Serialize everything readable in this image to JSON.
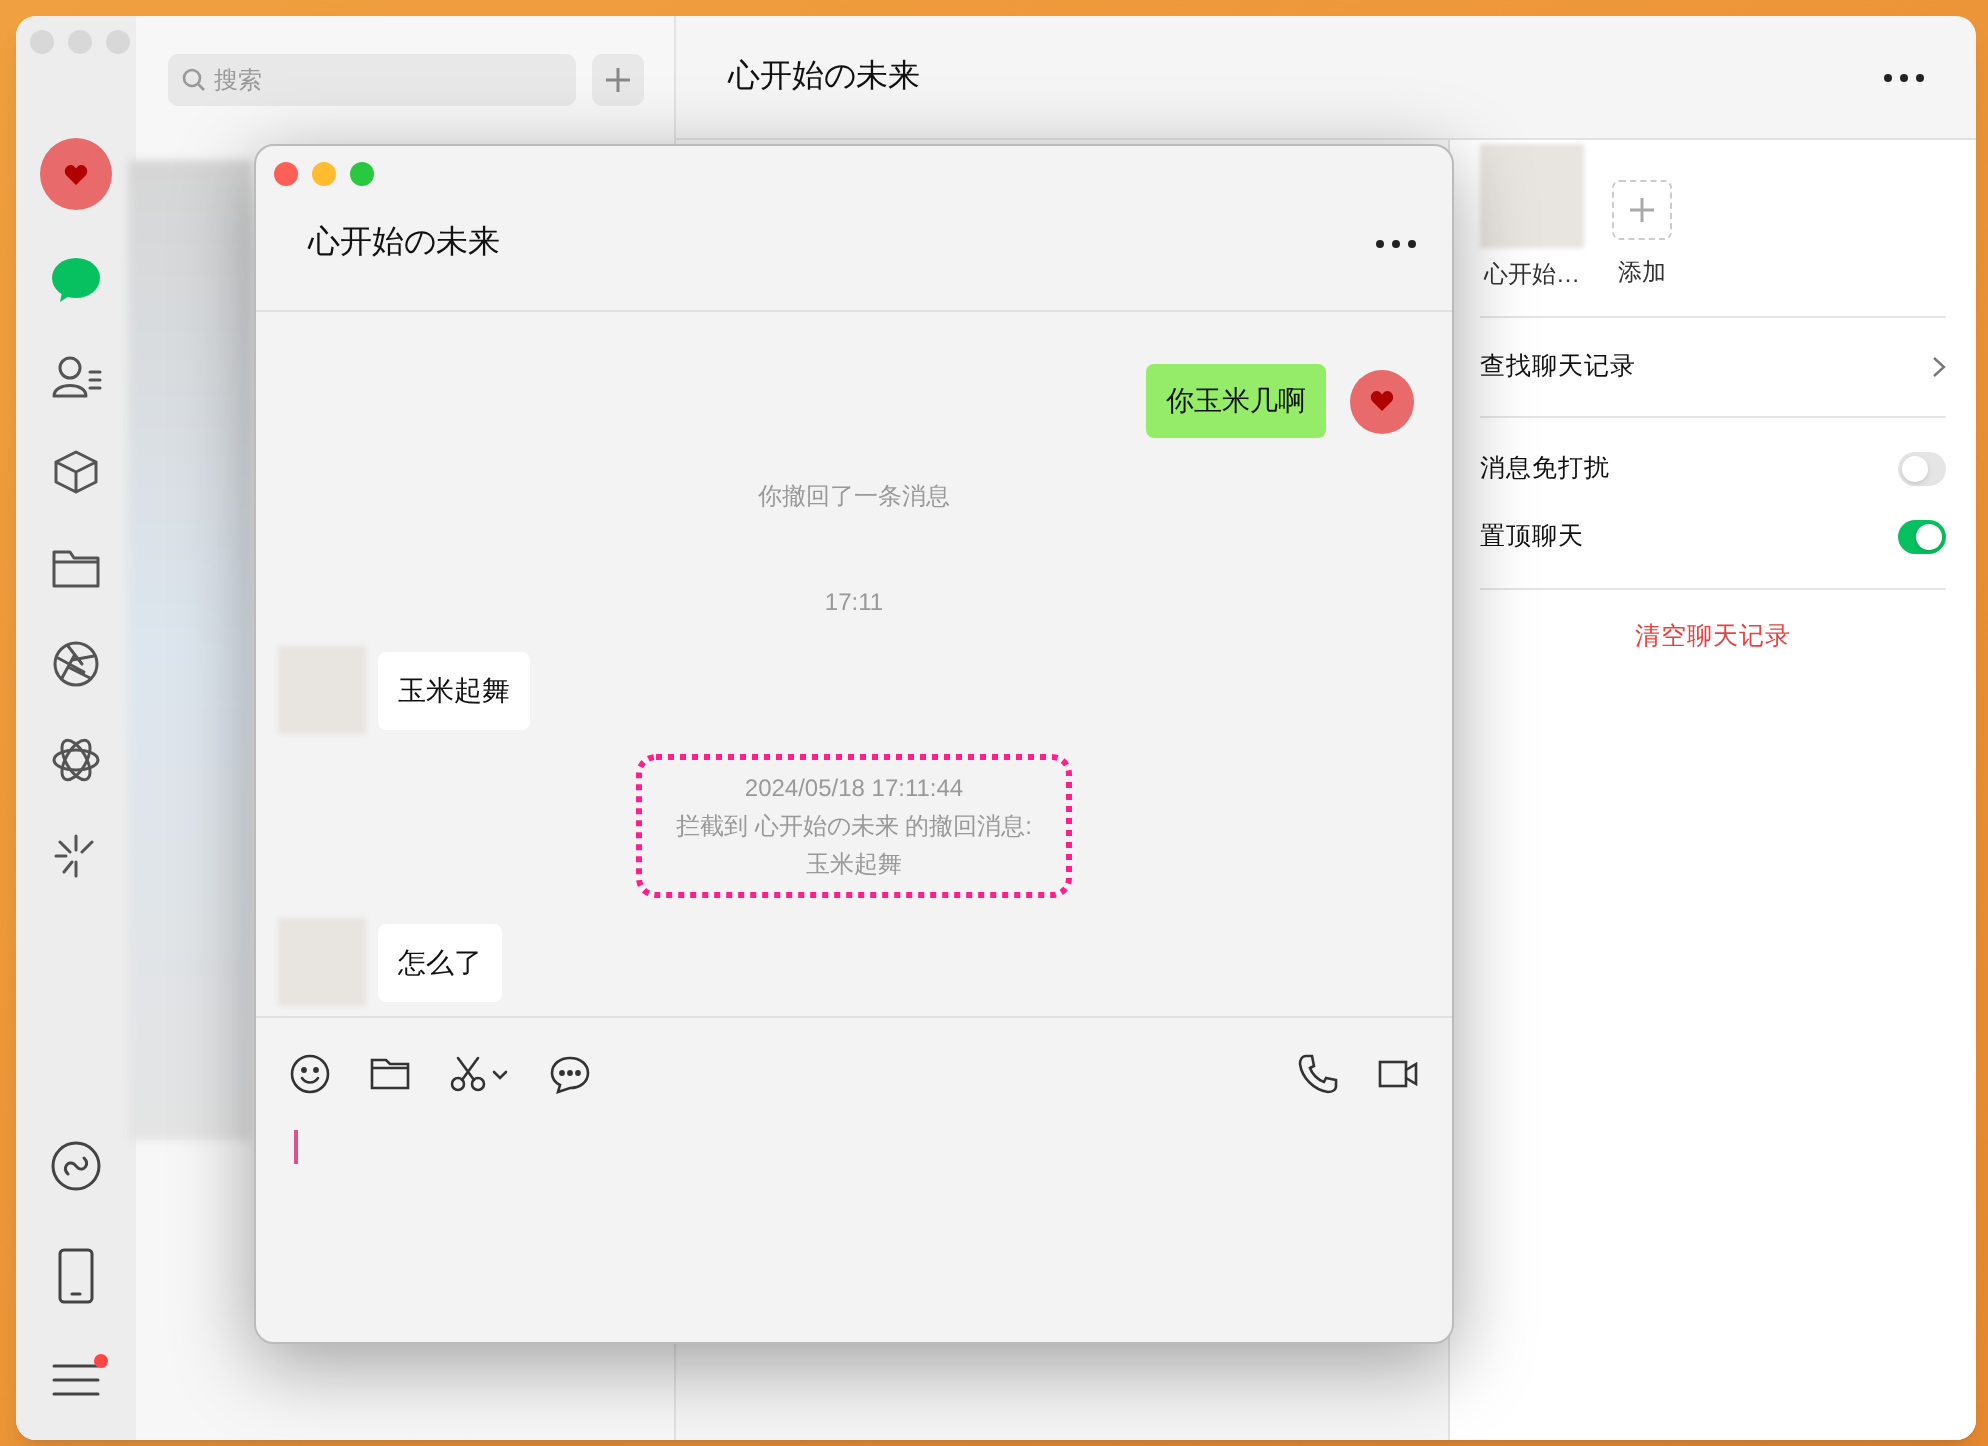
{
  "main_window": {
    "search": {
      "placeholder": "搜索"
    },
    "title": "心开始の未来",
    "sidebar": {
      "items": [
        {
          "kind": "chat",
          "selected": true
        },
        {
          "kind": "contacts",
          "selected": false
        },
        {
          "kind": "cube",
          "selected": false
        },
        {
          "kind": "folder",
          "selected": false
        },
        {
          "kind": "aperture",
          "selected": false
        },
        {
          "kind": "atom",
          "selected": false
        },
        {
          "kind": "sparkle",
          "selected": false
        }
      ],
      "bottom_items": [
        {
          "kind": "link"
        },
        {
          "kind": "phone"
        },
        {
          "kind": "menu",
          "badge": true
        }
      ]
    },
    "info_panel": {
      "members": [
        {
          "kind": "member",
          "name": "心开始…"
        },
        {
          "kind": "add",
          "name": "添加"
        }
      ],
      "find_history": "查找聊天记录",
      "toggles": [
        {
          "label": "消息免打扰",
          "on": false
        },
        {
          "label": "置顶聊天",
          "on": true
        }
      ],
      "clear_button": "清空聊天记录"
    }
  },
  "chat_window": {
    "title": "心开始の未来",
    "messages": [
      {
        "kind": "outgoing",
        "text": "你玉米几啊"
      },
      {
        "kind": "system",
        "text": "你撤回了一条消息"
      },
      {
        "kind": "time",
        "text": "17:11"
      },
      {
        "kind": "incoming",
        "text": "玉米起舞"
      },
      {
        "kind": "intercepted",
        "lines": [
          "2024/05/18 17:11:44",
          "拦截到 心开始の未来 的撤回消息:",
          "玉米起舞"
        ]
      },
      {
        "kind": "incoming",
        "text": "怎么了"
      }
    ]
  }
}
